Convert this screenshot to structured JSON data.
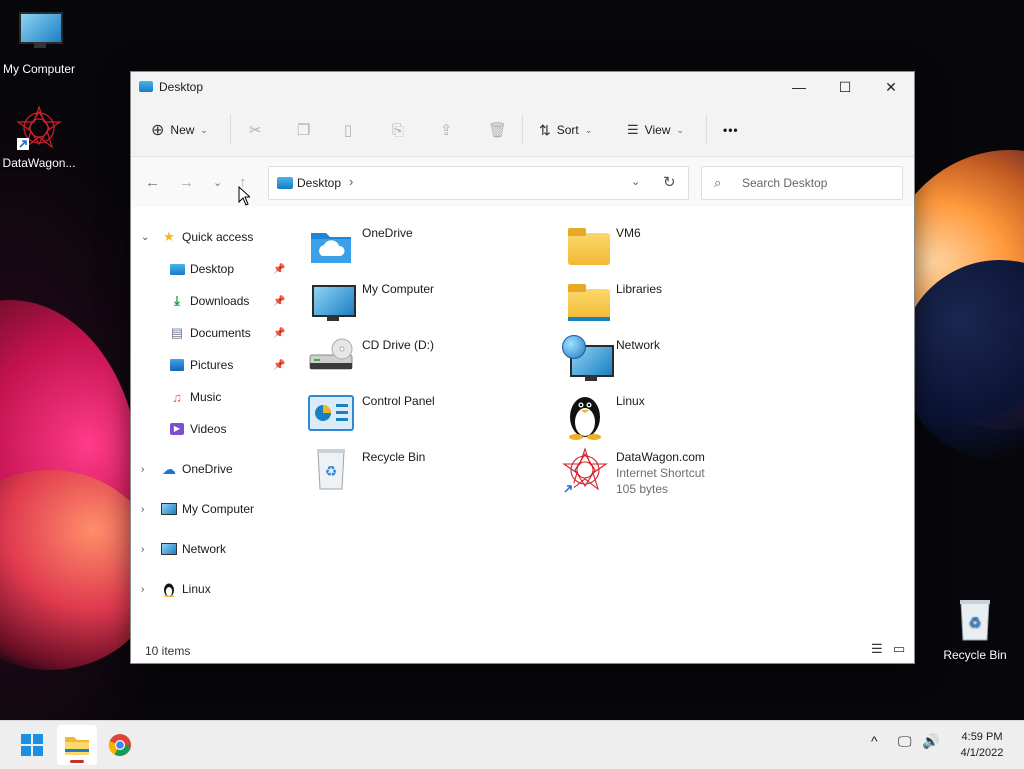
{
  "desktop": {
    "icons": [
      {
        "label": "My Computer"
      },
      {
        "label": "DataWagon..."
      },
      {
        "label": "Recycle Bin"
      }
    ]
  },
  "window": {
    "title": "Desktop",
    "controls": {
      "minimize": "—",
      "maximize": "☐",
      "close": "✕"
    }
  },
  "toolbar": {
    "new_label": "New",
    "sort_label": "Sort",
    "view_label": "View",
    "more_label": "•••"
  },
  "address": {
    "path": "Desktop",
    "search_placeholder": "Search Desktop"
  },
  "sidebar": {
    "quick_access": "Quick access",
    "pinned": [
      {
        "label": "Desktop"
      },
      {
        "label": "Downloads"
      },
      {
        "label": "Documents"
      },
      {
        "label": "Pictures"
      },
      {
        "label": "Music"
      },
      {
        "label": "Videos"
      }
    ],
    "roots": [
      {
        "label": "OneDrive"
      },
      {
        "label": "My Computer"
      },
      {
        "label": "Network"
      },
      {
        "label": "Linux"
      }
    ]
  },
  "content": {
    "items": [
      {
        "name": "OneDrive",
        "icon": "onedrive-folder-icon"
      },
      {
        "name": "VM6",
        "icon": "folder-icon"
      },
      {
        "name": "My Computer",
        "icon": "computer-icon"
      },
      {
        "name": "Libraries",
        "icon": "libraries-icon"
      },
      {
        "name": "CD Drive (D:)",
        "icon": "cd-drive-icon"
      },
      {
        "name": "Network",
        "icon": "network-icon"
      },
      {
        "name": "Control Panel",
        "icon": "control-panel-icon"
      },
      {
        "name": "Linux",
        "icon": "linux-penguin-icon"
      },
      {
        "name": "Recycle Bin",
        "icon": "recycle-bin-icon"
      },
      {
        "name": "DataWagon.com",
        "icon": "datawagon-shortcut-icon",
        "type": "Internet Shortcut",
        "size": "105 bytes"
      }
    ]
  },
  "status": {
    "item_count": "10 items"
  },
  "taskbar": {
    "time": "4:59 PM",
    "date": "4/1/2022"
  },
  "colors": {
    "accent": "#0067c0",
    "folder": "#f2b834",
    "close_hover": "#c42b1c"
  }
}
